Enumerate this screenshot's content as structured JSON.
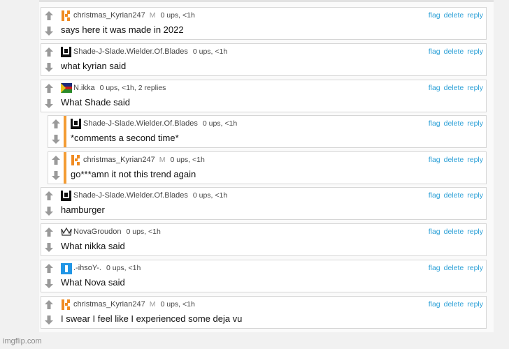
{
  "actions": {
    "flag": "flag",
    "delete": "delete",
    "reply": "reply"
  },
  "watermark": "imgflip.com",
  "comments": [
    {
      "username": "christmas_Kyrian247",
      "mod": "M",
      "meta": "0 ups, <1h",
      "text": "says here it was made in 2022",
      "avatar": "kyrian-k-icon",
      "reply": false
    },
    {
      "username": "Shade-J-Slade.Wielder.Of.Blades",
      "meta": "0 ups, <1h",
      "text": "what kyrian said",
      "avatar": "castle-icon",
      "reply": false
    },
    {
      "username": "N.ikka",
      "meta": "0 ups, <1h, 2 replies",
      "text": "What Shade said",
      "avatar": "flag-icon",
      "reply": false
    },
    {
      "username": "Shade-J-Slade.Wielder.Of.Blades",
      "meta": "0 ups, <1h",
      "text": "*comments a second time*",
      "avatar": "castle-icon",
      "reply": true
    },
    {
      "username": "christmas_Kyrian247",
      "mod": "M",
      "meta": "0 ups, <1h",
      "text": "go***amn it not this trend again",
      "avatar": "kyrian-k-icon",
      "reply": true
    },
    {
      "username": "Shade-J-Slade.Wielder.Of.Blades",
      "meta": "0 ups, <1h",
      "text": "hamburger",
      "avatar": "castle-icon",
      "reply": false
    },
    {
      "username": "NovaGroudon",
      "meta": "0 ups, <1h",
      "text": "What nikka said",
      "avatar": "crown-icon",
      "reply": false
    },
    {
      "username": ".-ihsoY-.",
      "meta": "0 ups, <1h",
      "text": "What Nova said",
      "avatar": "blue-bar-icon",
      "reply": false
    },
    {
      "username": "christmas_Kyrian247",
      "mod": "M",
      "meta": "0 ups, <1h",
      "text": "I swear I feel like I experienced some deja vu",
      "avatar": "kyrian-k-icon",
      "reply": false
    }
  ]
}
